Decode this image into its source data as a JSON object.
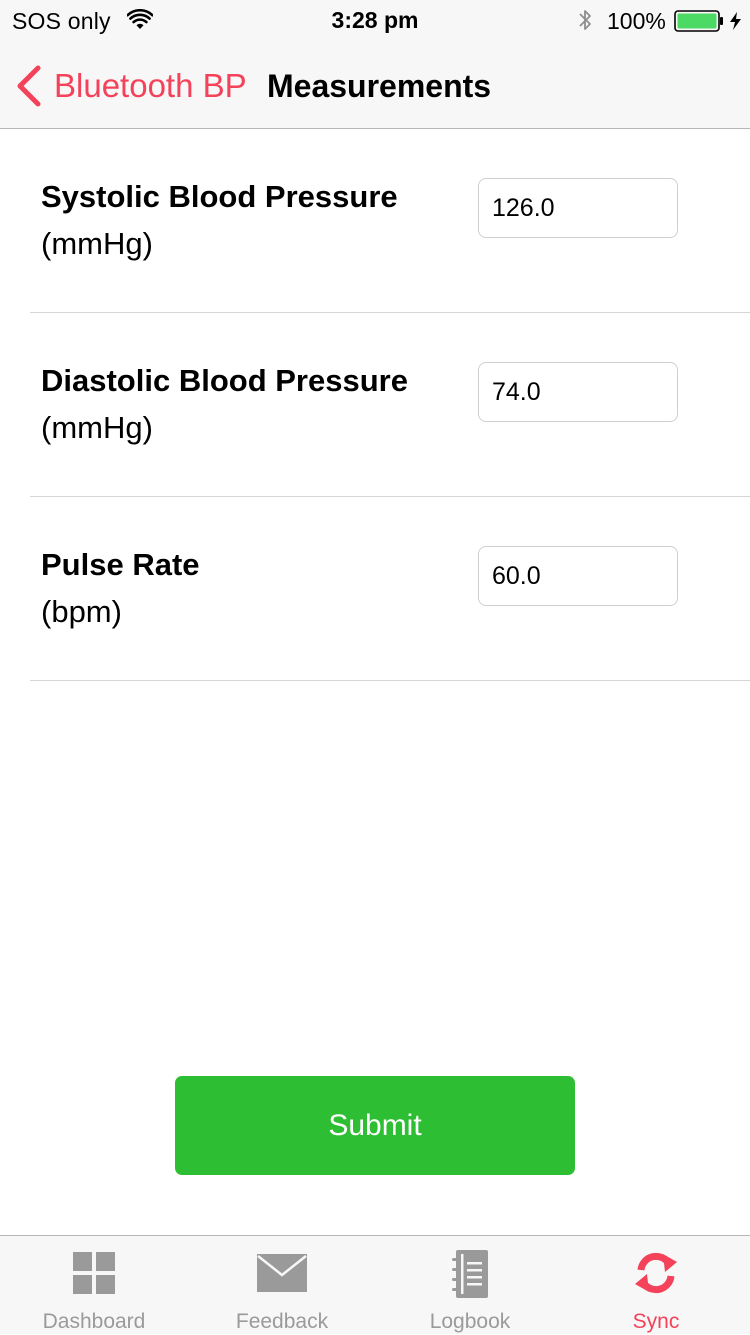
{
  "status_bar": {
    "carrier": "SOS only",
    "time": "3:28 pm",
    "battery_percent": "100%"
  },
  "nav": {
    "back_label": "Bluetooth BP",
    "title": "Measurements",
    "accent_color": "#f3425a"
  },
  "fields": [
    {
      "label": "Systolic Blood Pressure",
      "unit": "(mmHg)",
      "value": "126.0"
    },
    {
      "label": "Diastolic Blood Pressure",
      "unit": "(mmHg)",
      "value": "74.0"
    },
    {
      "label": "Pulse Rate",
      "unit": "(bpm)",
      "value": "60.0"
    }
  ],
  "submit": {
    "label": "Submit",
    "color": "#2dbe33"
  },
  "tabbar": {
    "items": [
      {
        "label": "Dashboard",
        "icon": "dashboard-grid-icon",
        "active": false
      },
      {
        "label": "Feedback",
        "icon": "envelope-icon",
        "active": false
      },
      {
        "label": "Logbook",
        "icon": "notebook-icon",
        "active": false
      },
      {
        "label": "Sync",
        "icon": "sync-icon",
        "active": true
      }
    ],
    "active_color": "#f3425a",
    "inactive_color": "#9a9a9a"
  }
}
